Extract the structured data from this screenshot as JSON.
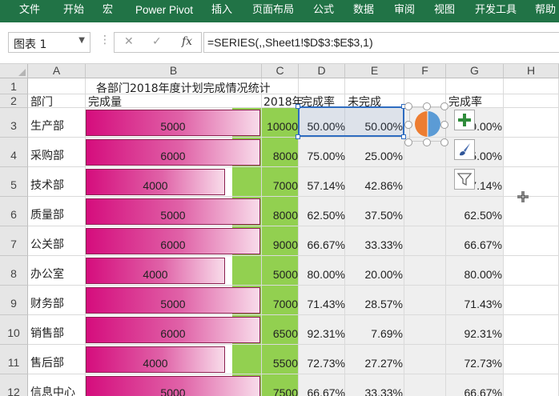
{
  "ribbon": {
    "tabs": [
      "文件",
      "开始",
      "宏",
      "Power Pivot",
      "插入",
      "页面布局",
      "公式",
      "数据",
      "审阅",
      "视图",
      "开发工具",
      "帮助"
    ]
  },
  "formula_bar": {
    "name_box": "图表 1",
    "cancel_icon": "✕",
    "enter_icon": "✓",
    "fx_label": "fx",
    "formula": "=SERIES(,,Sheet1!$D$3:$E$3,1)"
  },
  "columns": [
    "A",
    "B",
    "C",
    "D",
    "E",
    "F",
    "G",
    "H"
  ],
  "rows": [
    "1",
    "2",
    "3",
    "4",
    "5",
    "6",
    "7",
    "8",
    "9",
    "10",
    "11",
    "12"
  ],
  "sheet": {
    "title": "各部门2018年度计划完成情况统计",
    "headers": {
      "dept": "部门",
      "done": "完成量",
      "plan": "2018年",
      "rate": "完成率",
      "undone": "未完成",
      "rate2": "完成率"
    },
    "data": [
      {
        "dept": "生产部",
        "done": "5000",
        "plan": "10000",
        "rate": "50.00%",
        "undone": "50.00%",
        "rate2": "50.00%",
        "fill": 0.5
      },
      {
        "dept": "采购部",
        "done": "6000",
        "plan": "8000",
        "rate": "75.00%",
        "undone": "25.00%",
        "rate2": "75.00%",
        "fill": 0.6
      },
      {
        "dept": "技术部",
        "done": "4000",
        "plan": "7000",
        "rate": "57.14%",
        "undone": "42.86%",
        "rate2": "57.14%",
        "fill": 0.4
      },
      {
        "dept": "质量部",
        "done": "5000",
        "plan": "8000",
        "rate": "62.50%",
        "undone": "37.50%",
        "rate2": "62.50%",
        "fill": 0.5
      },
      {
        "dept": "公关部",
        "done": "6000",
        "plan": "9000",
        "rate": "66.67%",
        "undone": "33.33%",
        "rate2": "66.67%",
        "fill": 0.6
      },
      {
        "dept": "办公室",
        "done": "4000",
        "plan": "5000",
        "rate": "80.00%",
        "undone": "20.00%",
        "rate2": "80.00%",
        "fill": 0.4
      },
      {
        "dept": "财务部",
        "done": "5000",
        "plan": "7000",
        "rate": "71.43%",
        "undone": "28.57%",
        "rate2": "71.43%",
        "fill": 0.5
      },
      {
        "dept": "销售部",
        "done": "6000",
        "plan": "6500",
        "rate": "92.31%",
        "undone": "7.69%",
        "rate2": "92.31%",
        "fill": 0.6
      },
      {
        "dept": "售后部",
        "done": "4000",
        "plan": "5500",
        "rate": "72.73%",
        "undone": "27.27%",
        "rate2": "72.73%",
        "fill": 0.4
      },
      {
        "dept": "信息中心",
        "done": "5000",
        "plan": "7500",
        "rate": "66.67%",
        "undone": "33.33%",
        "rate2": "66.67%",
        "fill": 0.5
      }
    ]
  },
  "chart_buttons": [
    "chart-elements",
    "chart-styles",
    "chart-filters"
  ],
  "colors": {
    "ribbon": "#217346",
    "bar_start": "#d50d7d",
    "bar_end": "#f8dcea",
    "plan_fill": "#92d050",
    "pie_orange": "#ed7d31",
    "pie_blue": "#5b9bd5",
    "selection": "#2e6cc0"
  }
}
